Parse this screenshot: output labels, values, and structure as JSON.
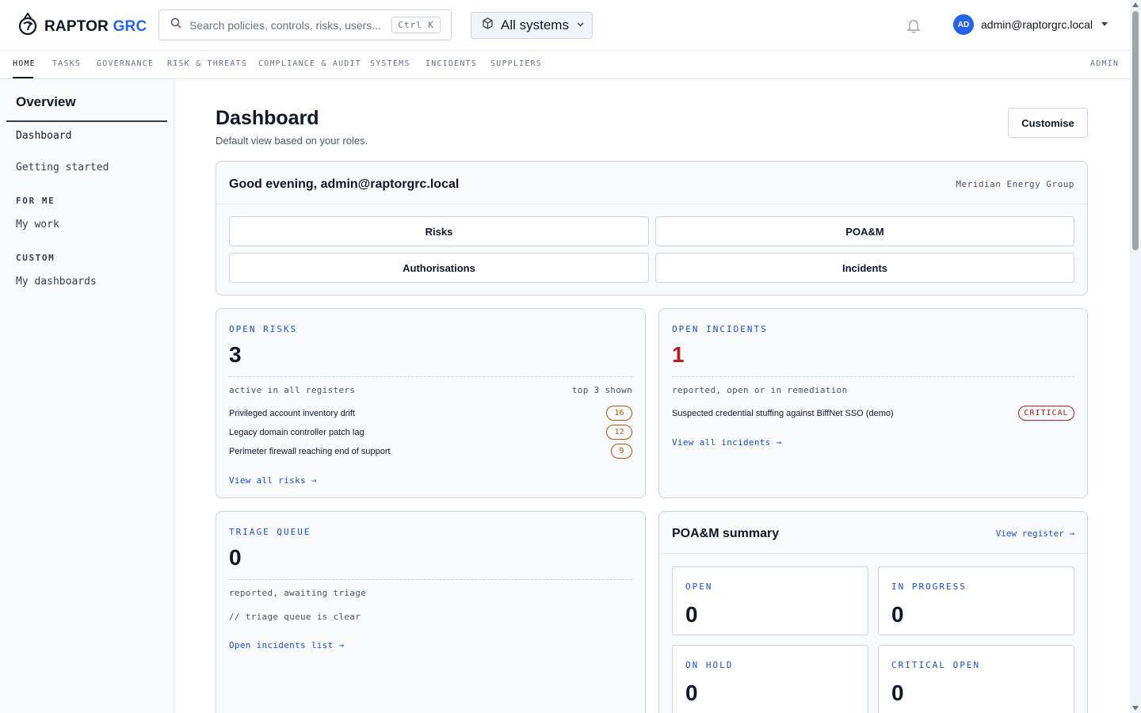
{
  "brand": {
    "name": "RAPTOR",
    "suffix": "GRC"
  },
  "search": {
    "placeholder": "Search policies, controls, risks, users...",
    "shortcut": "Ctrl K"
  },
  "system_selector": {
    "selected": "All systems"
  },
  "user": {
    "initials": "AD",
    "email": "admin@raptorgrc.local"
  },
  "nav": {
    "items": [
      "HOME",
      "TASKS",
      "GOVERNANCE",
      "RISK & THREATS",
      "COMPLIANCE & AUDIT",
      "SYSTEMS",
      "INCIDENTS",
      "SUPPLIERS"
    ],
    "admin": "ADMIN",
    "active": "HOME"
  },
  "sidebar": {
    "title": "Overview",
    "items": [
      "Dashboard",
      "Getting started"
    ],
    "sections": [
      {
        "heading": "FOR ME",
        "items": [
          "My work"
        ]
      },
      {
        "heading": "CUSTOM",
        "items": [
          "My dashboards"
        ]
      }
    ]
  },
  "page": {
    "title": "Dashboard",
    "subtitle": "Default view based on your roles.",
    "customise_label": "Customise"
  },
  "greeting": {
    "title": "Good evening, admin@raptorgrc.local",
    "org": "Meridian Energy Group",
    "quick_links": [
      "Risks",
      "POA&M",
      "Authorisations",
      "Incidents"
    ]
  },
  "open_risks": {
    "label": "OPEN RISKS",
    "value": "3",
    "meta_left": "active in all registers",
    "meta_right": "top 3 shown",
    "rows": [
      {
        "name": "Privileged account inventory drift",
        "score": "16"
      },
      {
        "name": "Legacy domain controller patch lag",
        "score": "12"
      },
      {
        "name": "Perimeter firewall reaching end of support",
        "score": "9"
      }
    ],
    "link": "View all risks →"
  },
  "open_incidents": {
    "label": "OPEN INCIDENTS",
    "value": "1",
    "meta": "reported, open or in remediation",
    "rows": [
      {
        "name": "Suspected credential stuffing against BiffNet SSO (demo)",
        "severity": "CRITICAL"
      }
    ],
    "link": "View all incidents →"
  },
  "triage": {
    "label": "TRIAGE QUEUE",
    "value": "0",
    "meta": "reported, awaiting triage",
    "note": "// triage queue is clear",
    "link": "Open incidents list →"
  },
  "poam": {
    "title": "POA&M summary",
    "link": "View register →",
    "tiles": [
      {
        "label": "OPEN",
        "value": "0"
      },
      {
        "label": "IN PROGRESS",
        "value": "0"
      },
      {
        "label": "ON HOLD",
        "value": "0"
      },
      {
        "label": "CRITICAL OPEN",
        "value": "0"
      }
    ]
  },
  "colors": {
    "accent": "#2563eb",
    "link": "#1d4ed8",
    "critical": "#b91c1c",
    "warning": "#b45309"
  }
}
